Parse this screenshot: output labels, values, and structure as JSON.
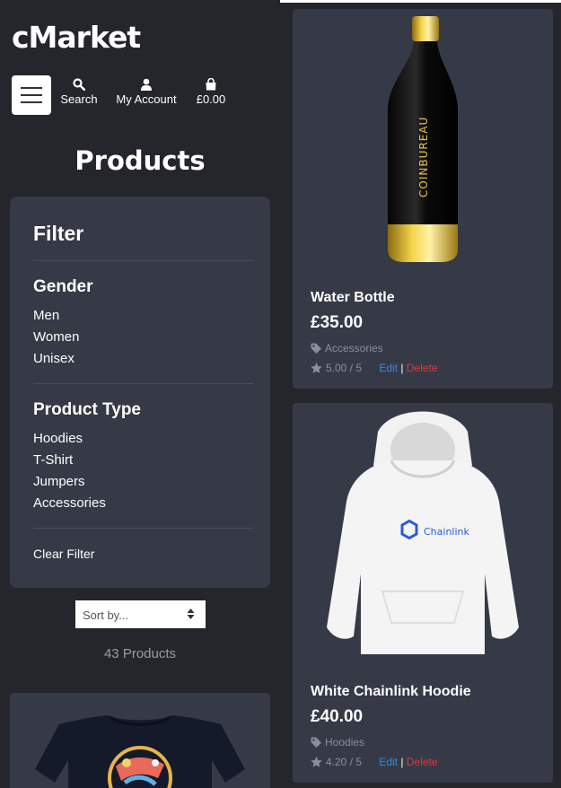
{
  "brand": {
    "logo": "cMarket"
  },
  "nav": {
    "search": "Search",
    "account": "My Account",
    "cart": "£0.00"
  },
  "page_title": "Products",
  "filter": {
    "title": "Filter",
    "gender_heading": "Gender",
    "gender": [
      "Men",
      "Women",
      "Unisex"
    ],
    "type_heading": "Product Type",
    "types": [
      "Hoodies",
      "T-Shirt",
      "Jumpers",
      "Accessories"
    ],
    "clear": "Clear Filter"
  },
  "sort": {
    "selected": "Sort by..."
  },
  "product_count": "43 Products",
  "products": [
    {
      "title": "Water Bottle",
      "price": "£35.00",
      "category": "Accessories",
      "rating": "5.00 / 5",
      "edit": "Edit",
      "sep": "|",
      "delete": "Delete",
      "image_text": "COINBUREAU"
    },
    {
      "title": "White Chainlink Hoodie",
      "price": "£40.00",
      "category": "Hoodies",
      "rating": "4.20 / 5",
      "edit": "Edit",
      "sep": "|",
      "delete": "Delete",
      "image_text": "Chainlink"
    }
  ],
  "colors": {
    "background": "#25262b",
    "panel": "#363a47",
    "edit": "#2d8cf0",
    "delete": "#e0393e"
  }
}
